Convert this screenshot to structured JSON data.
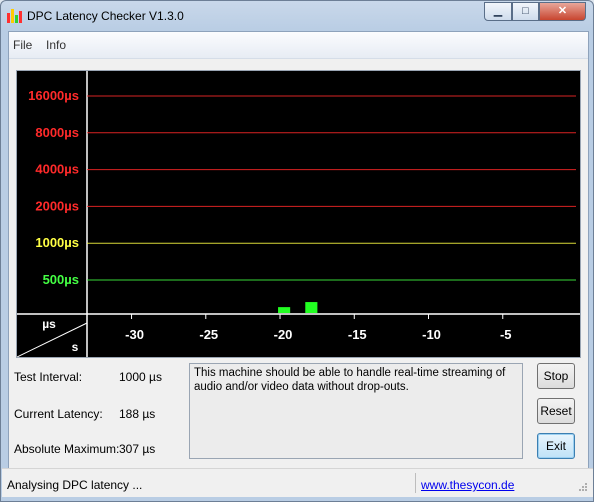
{
  "window": {
    "title": "DPC Latency Checker V1.3.0"
  },
  "menu": {
    "items": [
      "File",
      "Info"
    ]
  },
  "chart_data": {
    "type": "bar",
    "y_tick_labels": [
      "16000µs",
      "8000µs",
      "4000µs",
      "2000µs",
      "1000µs",
      "500µs"
    ],
    "y_tick_colors": [
      "#ff2a2a",
      "#ff2a2a",
      "#ff2a2a",
      "#ff2a2a",
      "#ffff44",
      "#44ff44"
    ],
    "y_scale": "log2",
    "y_ticks_us": [
      16000,
      8000,
      4000,
      2000,
      1000,
      500
    ],
    "x_unit": "s",
    "y_unit": "µs",
    "x_tick_labels": [
      "-30",
      "-25",
      "-20",
      "-15",
      "-10",
      "-5"
    ],
    "x_tick_values": [
      -30,
      -25,
      -20,
      -15,
      -10,
      -5
    ],
    "xlim": [
      -33,
      0
    ],
    "bar_color": "#22ff22",
    "bars_us": [
      240,
      230,
      230,
      210,
      230,
      230,
      210,
      210,
      230,
      210,
      210,
      230,
      230,
      250,
      300,
      240,
      330,
      240,
      200,
      200,
      200,
      230,
      230,
      210,
      210,
      230,
      230,
      210,
      210,
      230,
      230,
      200,
      230,
      250,
      250,
      210
    ]
  },
  "info": {
    "test_interval_label": "Test Interval:",
    "test_interval_value": "1000 µs",
    "current_latency_label": "Current Latency:",
    "current_latency_value": "188 µs",
    "absolute_max_label": "Absolute Maximum:",
    "absolute_max_value": "307 µs"
  },
  "message": "This machine should be able to handle real-time streaming of audio and/or video data without drop-outs.",
  "buttons": {
    "stop": "Stop",
    "reset": "Reset",
    "exit": "Exit"
  },
  "status": {
    "text": "Analysing DPC latency ...",
    "link": "www.thesycon.de"
  }
}
